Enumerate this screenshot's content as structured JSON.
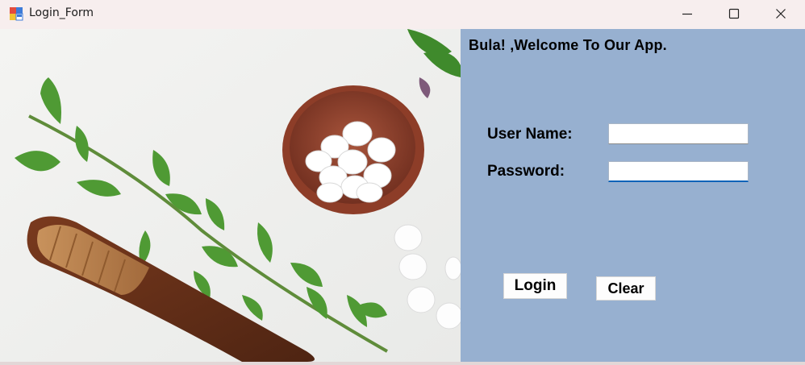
{
  "window": {
    "title": "Login_Form",
    "controls": {
      "minimize": "minimize",
      "maximize": "maximize",
      "close": "close"
    }
  },
  "panel": {
    "welcome": "Bula! ,Welcome To Our App.",
    "username_label": "User Name:",
    "password_label": "Password:",
    "username_value": "",
    "password_value": "",
    "login_label": "Login",
    "clear_label": "Clear",
    "background_color": "#97b0d0"
  },
  "image": {
    "description_icon": "herbal-medicine-photo"
  }
}
